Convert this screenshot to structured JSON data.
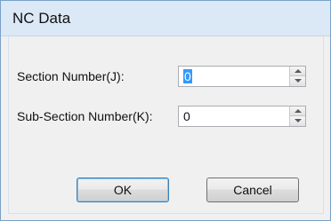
{
  "window": {
    "title": "NC Data"
  },
  "fields": [
    {
      "label": "Section Number(J):",
      "value": "0"
    },
    {
      "label": "Sub-Section Number(K):",
      "value": "0"
    }
  ],
  "buttons": {
    "ok": "OK",
    "cancel": "Cancel"
  }
}
